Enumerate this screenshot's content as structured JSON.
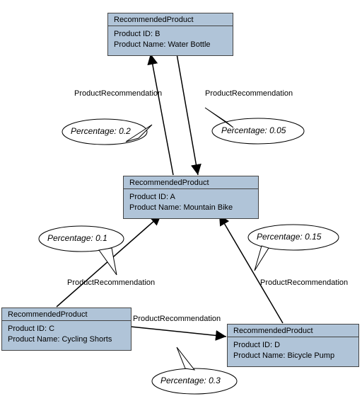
{
  "entity_type_label": "RecommendedProduct",
  "field_labels": {
    "id": "Product ID",
    "name": "Product Name"
  },
  "edge_type_label": "ProductRecommendation",
  "percentage_label": "Percentage",
  "nodes": {
    "A": {
      "id": "A",
      "name": "Mountain Bike"
    },
    "B": {
      "id": "B",
      "name": "Water Bottle"
    },
    "C": {
      "id": "C",
      "name": "Cycling Shorts"
    },
    "D": {
      "id": "D",
      "name": "Bicycle Pump"
    }
  },
  "edges": {
    "A_to_B": {
      "from": "A",
      "to": "B",
      "percentage": "0.2"
    },
    "B_to_A": {
      "from": "B",
      "to": "A",
      "percentage": "0.05"
    },
    "C_to_A": {
      "from": "C",
      "to": "A",
      "percentage": "0.1"
    },
    "D_to_A": {
      "from": "D",
      "to": "A",
      "percentage": "0.15"
    },
    "C_to_D": {
      "from": "C",
      "to": "D",
      "percentage": "0.3"
    }
  }
}
